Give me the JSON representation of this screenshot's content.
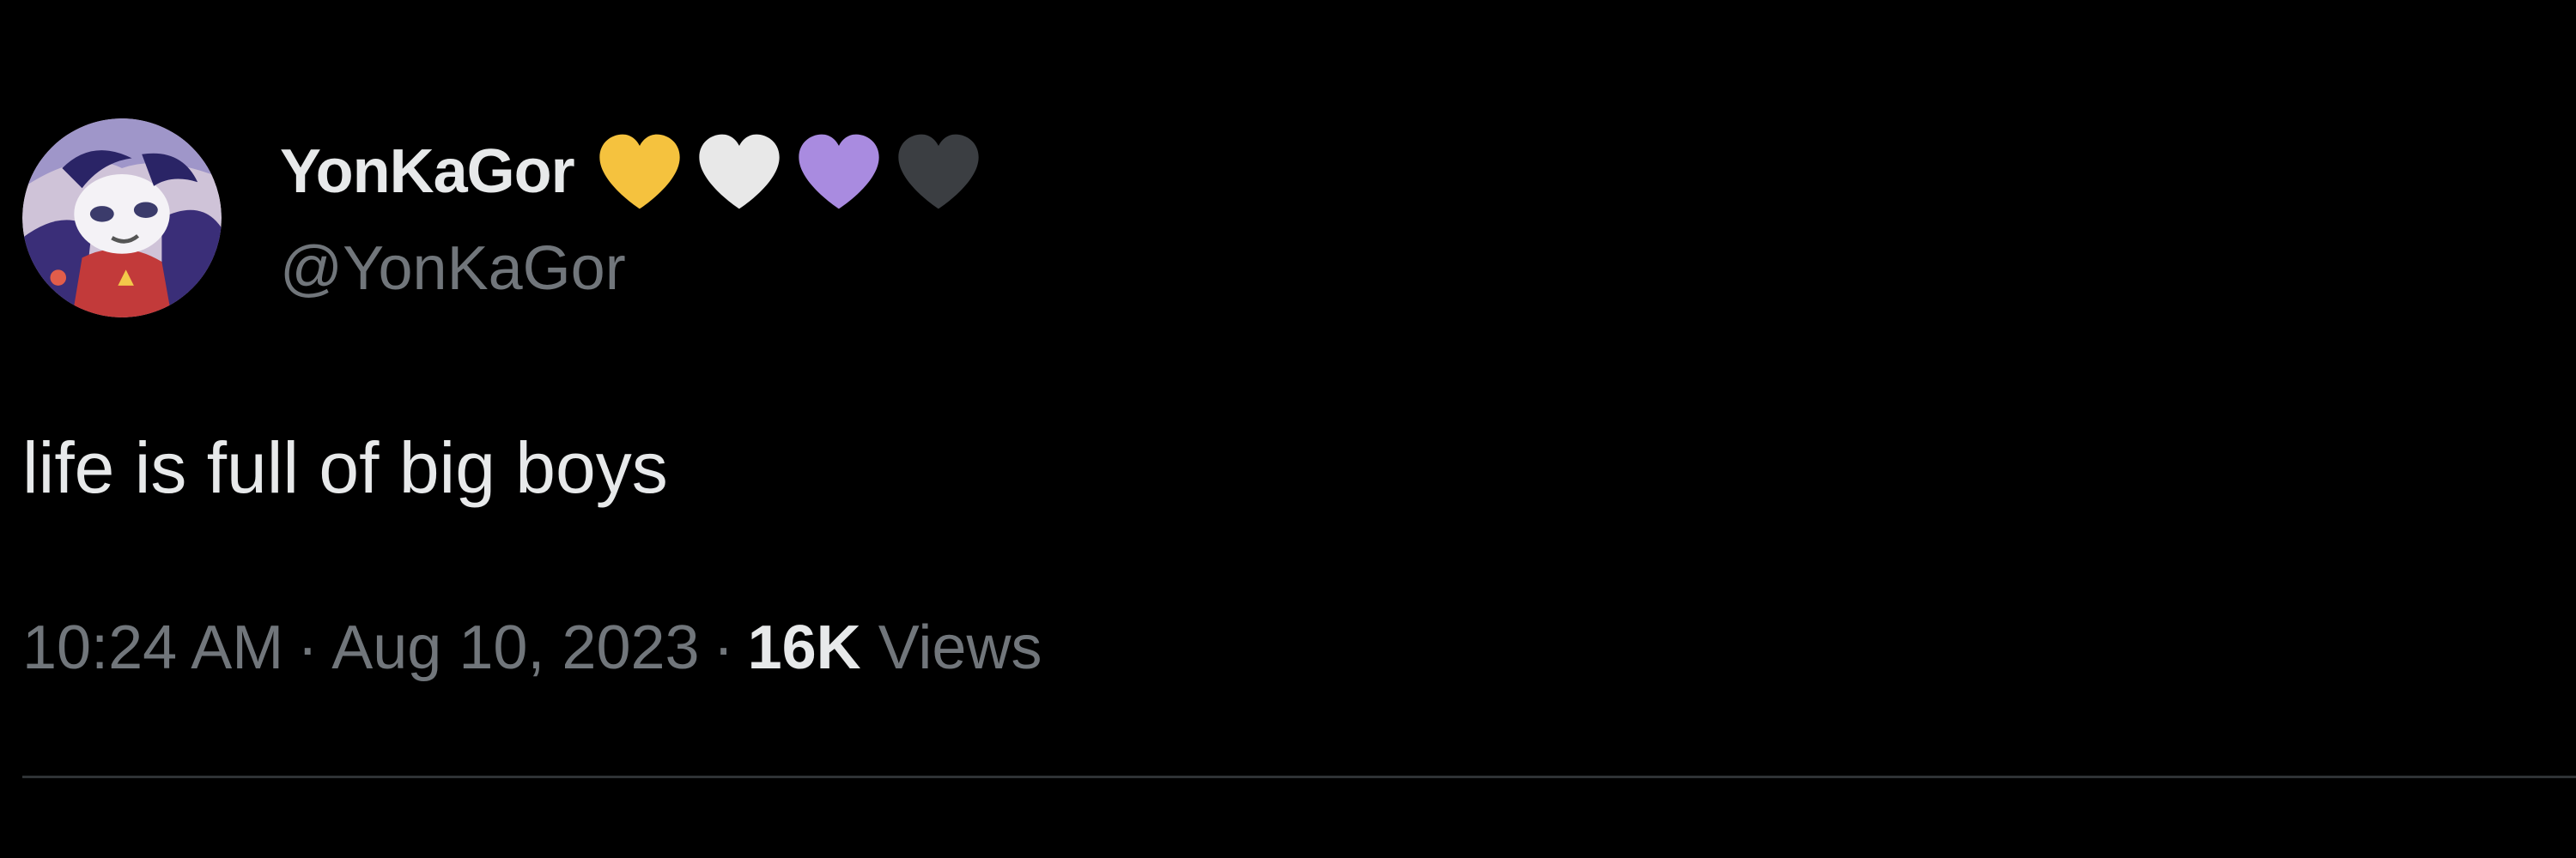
{
  "tweet": {
    "display_name": "YonKaGor",
    "handle": "@YonKaGor",
    "name_hearts": [
      {
        "icon": "yellow-heart-icon",
        "color": "#f5c23e"
      },
      {
        "icon": "white-heart-icon",
        "color": "#e8e8e8"
      },
      {
        "icon": "purple-heart-icon",
        "color": "#a98be0"
      },
      {
        "icon": "black-heart-icon",
        "color": "#3b3e42"
      }
    ],
    "text": "life is full of big boys",
    "time": "10:24 AM",
    "separator": "·",
    "date": "Aug 10, 2023",
    "views_count": "16K",
    "views_label": "Views"
  },
  "colors": {
    "background": "#000000",
    "primary_text": "#e7e9ea",
    "secondary_text": "#71767b",
    "divider": "#2f3336"
  }
}
